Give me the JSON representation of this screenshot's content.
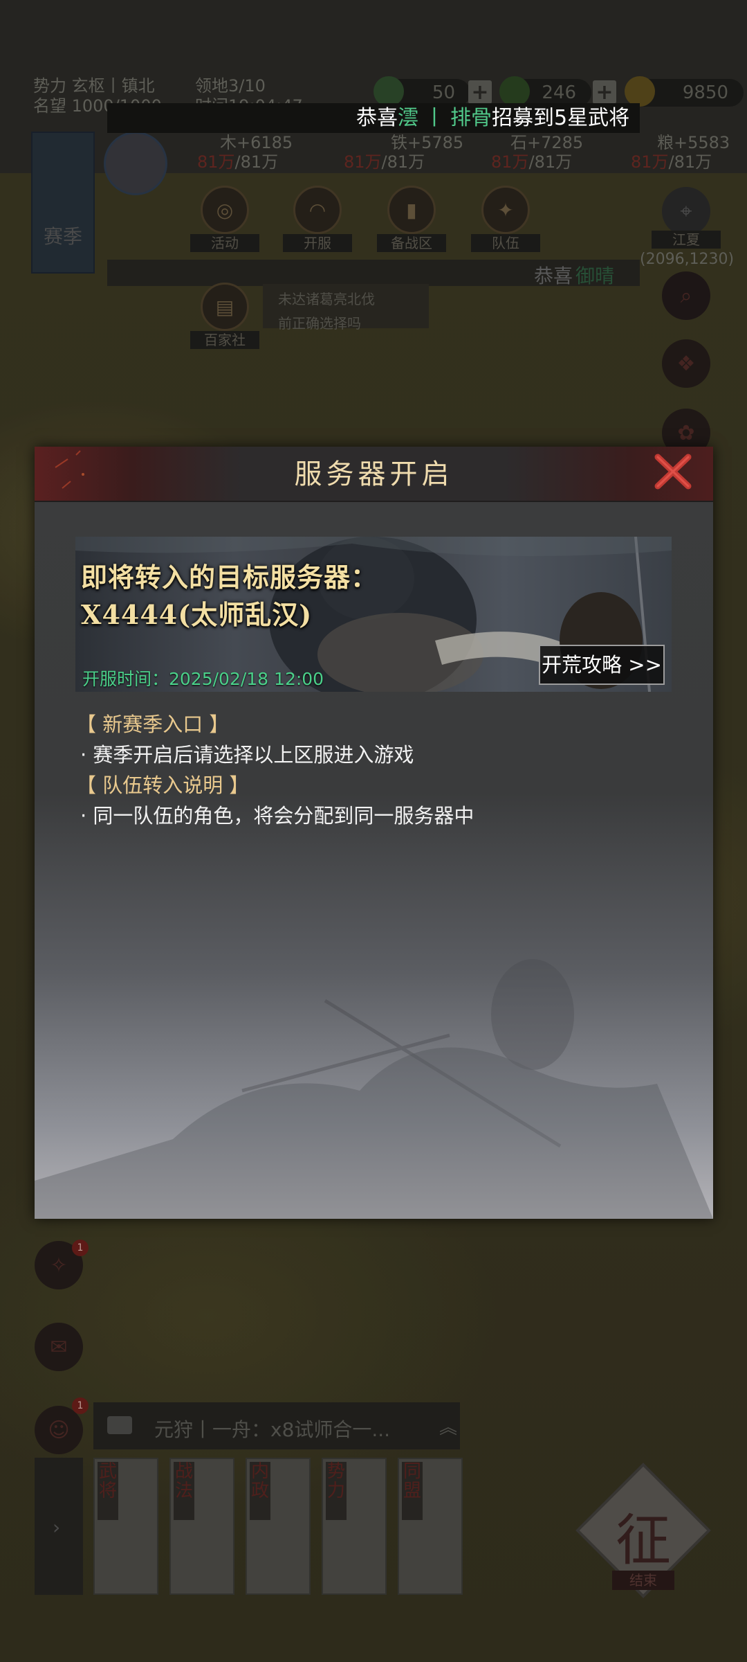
{
  "hud": {
    "faction": "势力 玄枢丨镇北",
    "territory": "领地3/10",
    "fame": "名望 1000/1000",
    "time": "时间19:04:47",
    "res_a": "50",
    "res_b": "246",
    "res_c": "9850",
    "wood": "木+6185",
    "wood_cap": "/81万",
    "iron": "铁+5785",
    "iron_cap": "/81万",
    "stone": "石+7285",
    "stone_cap": "/81万",
    "grain": "粮+5583",
    "grain_cap": "/81万",
    "season_tag": "赛季",
    "menu": [
      "活动",
      "开服",
      "备战区",
      "队伍"
    ],
    "location_label": "江夏",
    "coords": "(2096,1230)",
    "second_ticker": "恭喜",
    "second_ticker_name": "御晴",
    "baijia_label": "百家社",
    "baijia_text1": "未达诸葛亮北伐",
    "baijia_text2": "前正确选择吗",
    "chat_preview": "元狩丨一舟：x8试师合一...",
    "card_tags": [
      "武将",
      "战法",
      "内政",
      "势力",
      "同盟"
    ],
    "conquer_label": "征",
    "conquer_sub": "结束",
    "badge_1": "1",
    "badge_2": "1"
  },
  "ticker": {
    "prefix": "恭喜",
    "name1": "澐",
    "sep": "丨",
    "name2": "排骨",
    "suffix": "招募到5星武将"
  },
  "modal": {
    "title": "服务器开启",
    "banner_line1": "即将转入的目标服务器：",
    "banner_line2": "X4444(太师乱汉)",
    "open_time": "开服时间：2025/02/18 12:00",
    "guide_button": "开荒攻略 >>",
    "section1_head": "【 新赛季入口 】",
    "section1_body": "· 赛季开启后请选择以上区服进入游戏",
    "section2_head": "【 队伍转入说明 】",
    "section2_body": "· 同一队伍的角色，将会分配到同一服务器中"
  },
  "colors": {
    "title_gold": "#f0dcae",
    "banner_gold": "#f3dfa3",
    "section_gold": "#e9c98e",
    "green": "#4bd08a",
    "close_red": "#c23a33"
  }
}
